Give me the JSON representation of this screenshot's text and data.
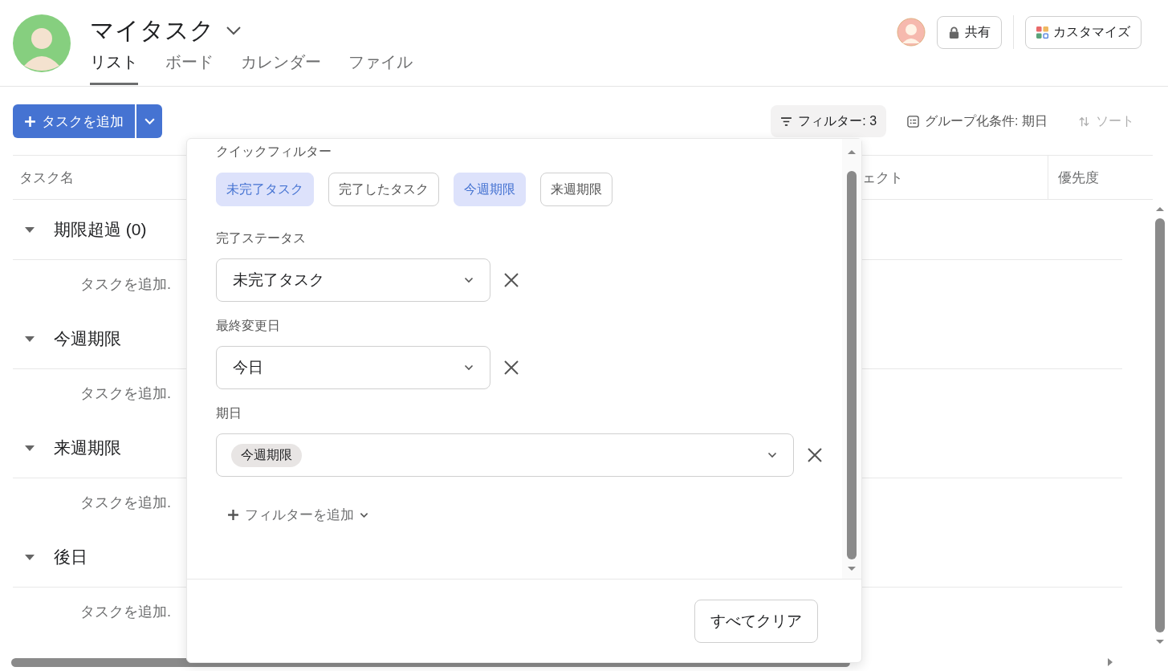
{
  "project": {
    "title": "マイタスク"
  },
  "tabs": [
    {
      "label": "リスト",
      "selected": true
    },
    {
      "label": "ボード",
      "selected": false
    },
    {
      "label": "カレンダー",
      "selected": false
    },
    {
      "label": "ファイル",
      "selected": false
    }
  ],
  "header_actions": {
    "share": "共有",
    "customize": "カスタマイズ"
  },
  "toolbar": {
    "add_task": "タスクを追加",
    "filter": "フィルター: 3",
    "group_by": "グループ化条件: 期日",
    "sort": {
      "label": "ソート",
      "disabled": true
    }
  },
  "table": {
    "columns": [
      "タスク名",
      "ェクト",
      "優先度"
    ],
    "groups": [
      {
        "name": "期限超過 (0)",
        "expanded": true,
        "add_row": "タスクを追加."
      },
      {
        "name": "今週期限",
        "expanded": true,
        "add_row": "タスクを追加."
      },
      {
        "name": "来週期限",
        "expanded": true,
        "add_row": "タスクを追加."
      },
      {
        "name": "後日",
        "expanded": true,
        "add_row": "タスクを追加."
      }
    ]
  },
  "filter_panel": {
    "quick_title": "クイックフィルター",
    "quick_filters": [
      {
        "label": "未完了タスク",
        "selected": true
      },
      {
        "label": "完了したタスク",
        "selected": false
      },
      {
        "label": "今週期限",
        "selected": true
      },
      {
        "label": "来週期限",
        "selected": false
      }
    ],
    "filters": [
      {
        "label": "完了ステータス",
        "kind": "select",
        "value": "未完了タスク"
      },
      {
        "label": "最終変更日",
        "kind": "select",
        "value": "今日"
      },
      {
        "label": "期日",
        "kind": "tags",
        "tags": [
          "今週期限"
        ]
      }
    ],
    "add_filter": "フィルターを追加",
    "clear_all": "すべてクリア"
  }
}
